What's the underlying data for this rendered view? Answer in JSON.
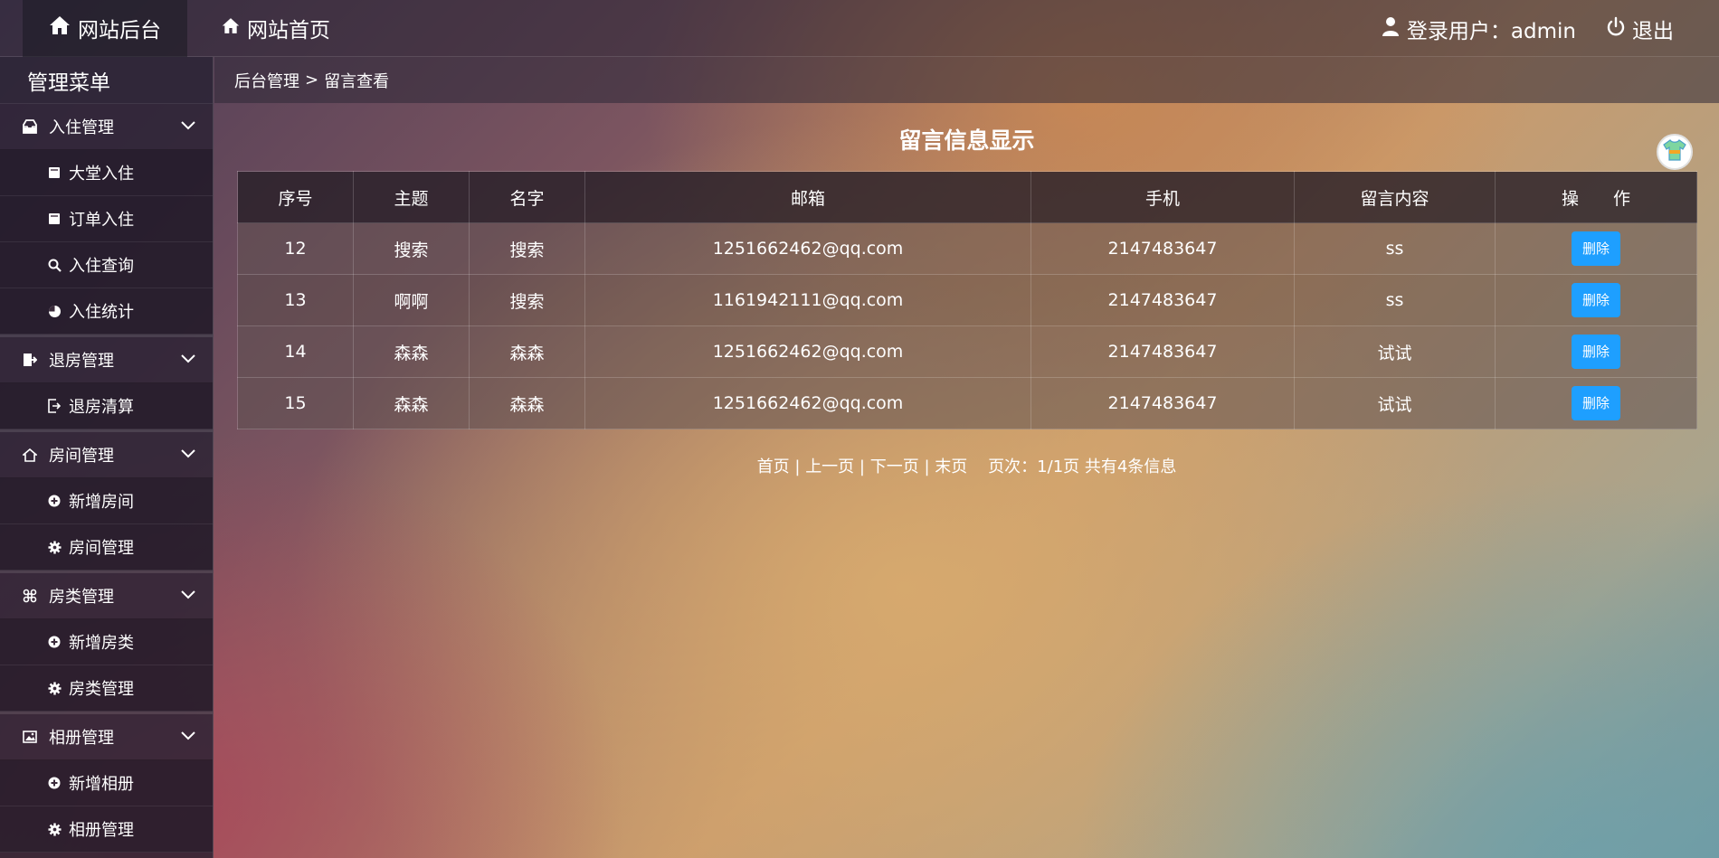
{
  "topbar": {
    "brand_label": "网站后台",
    "home_label": "网站首页",
    "user_label": "登录用户：admin",
    "logout_label": "退出"
  },
  "sidebar": {
    "title": "管理菜单",
    "groups": [
      {
        "label": "入住管理",
        "icon": "inbox-icon",
        "items": [
          {
            "label": "大堂入住",
            "icon": "note-icon"
          },
          {
            "label": "订单入住",
            "icon": "note-icon"
          },
          {
            "label": "入住查询",
            "icon": "search-icon"
          },
          {
            "label": "入住统计",
            "icon": "pie-chart-icon"
          }
        ]
      },
      {
        "label": "退房管理",
        "icon": "checkout-icon",
        "items": [
          {
            "label": "退房清算",
            "icon": "exit-icon"
          }
        ]
      },
      {
        "label": "房间管理",
        "icon": "home-icon",
        "items": [
          {
            "label": "新增房间",
            "icon": "plus-circle-icon"
          },
          {
            "label": "房间管理",
            "icon": "gear-icon"
          }
        ]
      },
      {
        "label": "房类管理",
        "icon": "command-icon",
        "items": [
          {
            "label": "新增房类",
            "icon": "plus-circle-icon"
          },
          {
            "label": "房类管理",
            "icon": "gear-icon"
          }
        ]
      },
      {
        "label": "相册管理",
        "icon": "image-icon",
        "items": [
          {
            "label": "新增相册",
            "icon": "plus-circle-icon"
          },
          {
            "label": "相册管理",
            "icon": "gear-icon"
          }
        ]
      }
    ]
  },
  "breadcrumb": {
    "root": "后台管理",
    "separator": ">",
    "current": "留言查看"
  },
  "main": {
    "title": "留言信息显示",
    "columns": [
      "序号",
      "主题",
      "名字",
      "邮箱",
      "手机",
      "留言内容",
      "操　　作"
    ],
    "rows": [
      {
        "id": "12",
        "subject": "搜索",
        "name": "搜索",
        "email": "1251662462@qq.com",
        "phone": "2147483647",
        "content": "ss",
        "action": "删除"
      },
      {
        "id": "13",
        "subject": "啊啊",
        "name": "搜索",
        "email": "1161942111@qq.com",
        "phone": "2147483647",
        "content": "ss",
        "action": "删除"
      },
      {
        "id": "14",
        "subject": "森森",
        "name": "森森",
        "email": "1251662462@qq.com",
        "phone": "2147483647",
        "content": "试试",
        "action": "删除"
      },
      {
        "id": "15",
        "subject": "森森",
        "name": "森森",
        "email": "1251662462@qq.com",
        "phone": "2147483647",
        "content": "试试",
        "action": "删除"
      }
    ]
  },
  "pager": {
    "first": "首页",
    "prev": "上一页",
    "next": "下一页",
    "last": "末页",
    "page_info": "页次：1/1页 共有4条信息"
  },
  "colors": {
    "delete_button": "#1e9fff"
  }
}
